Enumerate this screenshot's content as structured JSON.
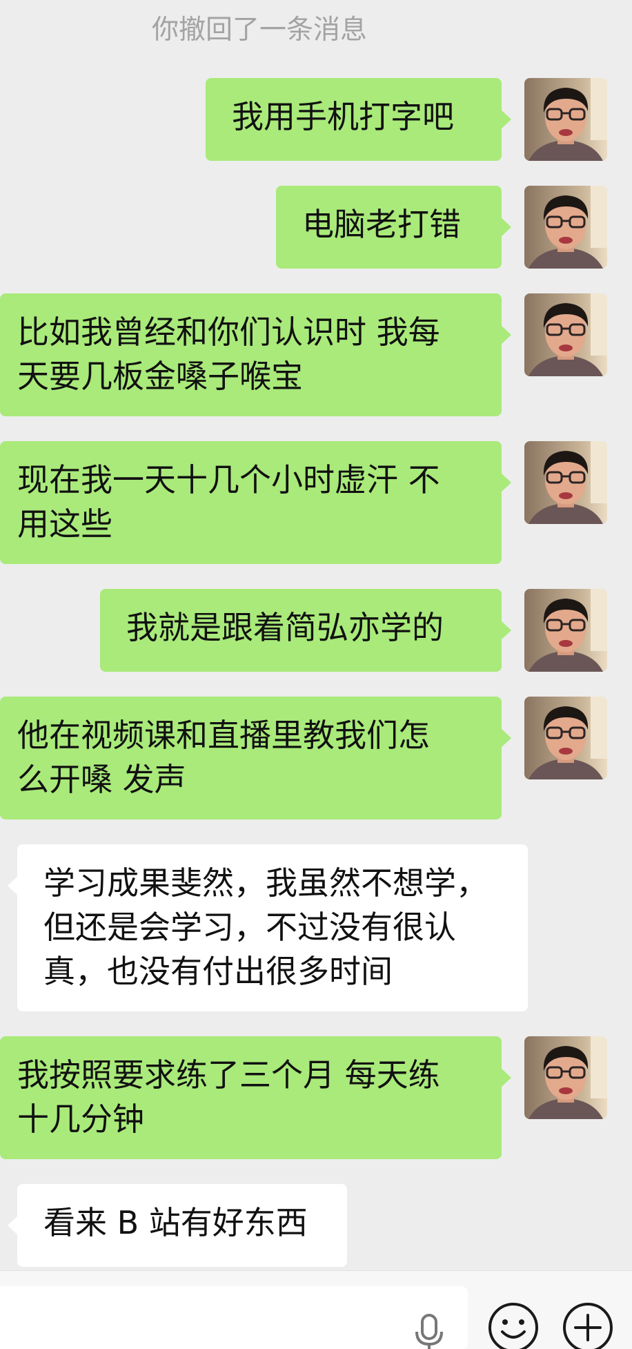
{
  "notice": {
    "recall_text": "你撤回了一条消息"
  },
  "messages": [
    {
      "sender": "me",
      "lines": [
        "我用手机打字吧"
      ]
    },
    {
      "sender": "me",
      "lines": [
        "电脑老打错"
      ]
    },
    {
      "sender": "me",
      "lines": [
        "比如我曾经和你们认识时 我每",
        "天要几板金嗓子喉宝"
      ]
    },
    {
      "sender": "me",
      "lines": [
        "现在我一天十几个小时虚汗 不",
        "用这些"
      ]
    },
    {
      "sender": "me",
      "lines": [
        "我就是跟着简弘亦学的"
      ]
    },
    {
      "sender": "me",
      "lines": [
        "他在视频课和直播里教我们怎",
        "么开嗓 发声"
      ]
    },
    {
      "sender": "other",
      "lines": [
        "学习成果斐然，我虽然不想学，",
        "但还是会学习，不过没有很认",
        "真，也没有付出很多时间"
      ]
    },
    {
      "sender": "me",
      "lines": [
        "我按照要求练了三个月 每天练",
        "十几分钟"
      ]
    },
    {
      "sender": "other",
      "lines": [
        "看来 B 站有好东西"
      ]
    }
  ],
  "input": {
    "value": ""
  },
  "icons": {
    "avatar": "user-avatar-photo",
    "voice": "microphone-icon",
    "emoji": "emoji-smile-icon",
    "more": "plus-circle-icon"
  },
  "colors": {
    "outgoing_bubble": "#a9ea7a",
    "incoming_bubble": "#ffffff",
    "background": "#ededed",
    "notice_text": "#a3a3a3"
  }
}
